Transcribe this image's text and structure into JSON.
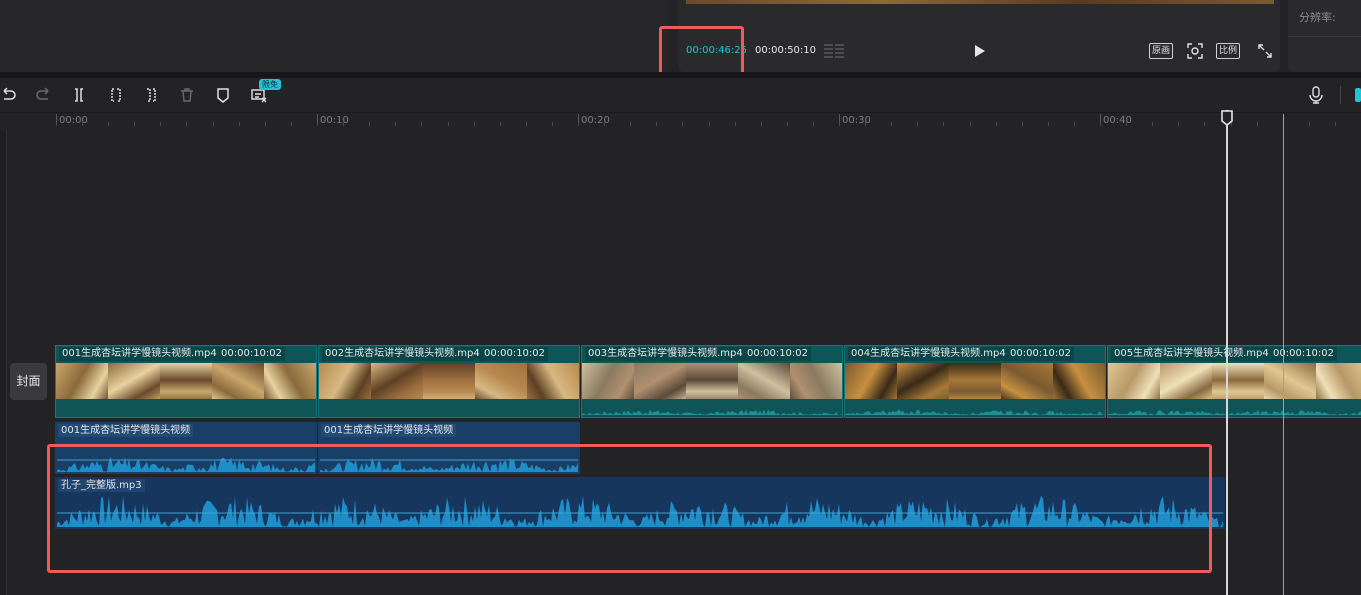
{
  "player": {
    "current_time": "00:00:46:25",
    "total_time": "00:00:50:10",
    "btn_original": "原画",
    "btn_ratio": "比例"
  },
  "right_panel": {
    "resolution_label": "分辨率:"
  },
  "toolbar": {
    "badge": "限免"
  },
  "ruler": {
    "ticks": [
      "00:00",
      "00:10",
      "00:20",
      "00:30",
      "00:40"
    ]
  },
  "cover": {
    "label": "封面"
  },
  "video_clips": [
    {
      "name": "001生成杏坛讲学慢镜头视频.mp4",
      "duration": "00:00:10:02"
    },
    {
      "name": "002生成杏坛讲学慢镜头视频.mp4",
      "duration": "00:00:10:02"
    },
    {
      "name": "003生成杏坛讲学慢镜头视频.mp4",
      "duration": "00:00:10:02"
    },
    {
      "name": "004生成杏坛讲学慢镜头视频.mp4",
      "duration": "00:00:10:02"
    },
    {
      "name": "005生成杏坛讲学慢镜头视频.mp4",
      "duration": "00:00:10:02"
    }
  ],
  "audio_clips": [
    {
      "name": "001生成杏坛讲学慢镜头视频"
    },
    {
      "name": "001生成杏坛讲学慢镜头视频"
    }
  ],
  "music": {
    "name": "孔子_完整版.mp3"
  },
  "colors": {
    "accent": "#22c3d6",
    "video_track": "#0f5557",
    "audio_track": "#1a3f66",
    "highlight": "#ef5a5a",
    "marker": "#c9a227"
  }
}
